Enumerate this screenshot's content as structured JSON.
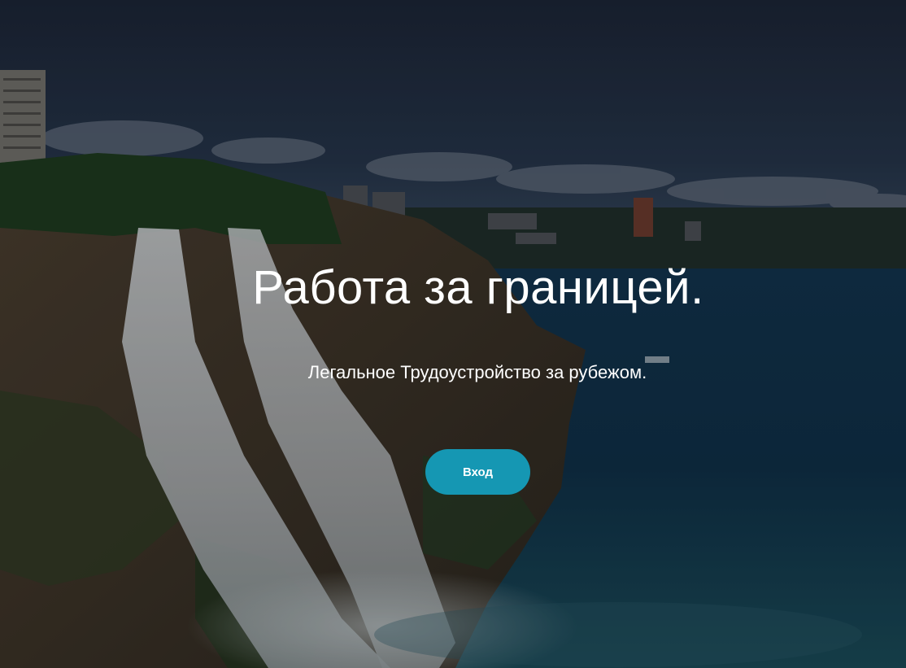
{
  "hero": {
    "title": "Работа за границей.",
    "subtitle": "Легальное Трудоустройство за рубежом.",
    "login_label": "Вход"
  },
  "colors": {
    "button": "#1597b3",
    "sky": "#22304a",
    "sea": "#113450"
  }
}
